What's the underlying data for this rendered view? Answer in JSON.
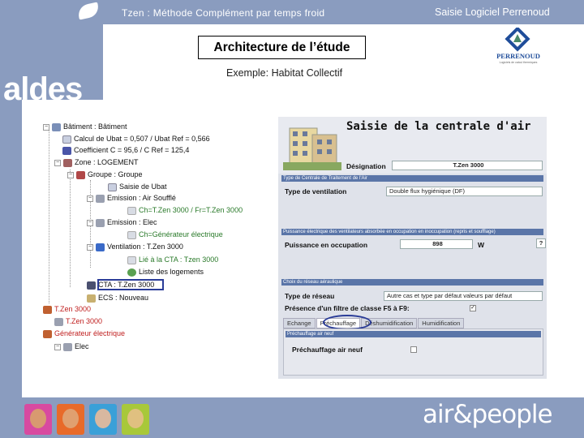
{
  "header": {
    "left_text": "Tzen : Méthode Complément par temps froid",
    "right_text": "Saisie Logiciel Perrenoud"
  },
  "brand": {
    "aldes": "aldes",
    "perrenoud": "PERRENOUD",
    "perrenoud_tagline": "Logiciels de calcul thermiques",
    "footer": "air&people"
  },
  "slide": {
    "title": "Architecture de l’étude",
    "subtitle": "Exemple: Habitat Collectif"
  },
  "tree": {
    "items": [
      {
        "label": "Bâtiment : Bâtiment",
        "icon": "building-icon"
      },
      {
        "label": "Calcul de Ubat = 0,507 / Ubat Ref = 0,566",
        "icon": "ubat-icon"
      },
      {
        "label": "Coefficient C = 95,6 / C Ref = 125,4",
        "icon": "coefficient-icon"
      },
      {
        "label": "Zone : LOGEMENT",
        "icon": "zone-icon"
      },
      {
        "label": "Groupe : Groupe",
        "icon": "group-icon"
      },
      {
        "label": "Saisie de Ubat",
        "icon": "ubat-icon"
      },
      {
        "label": "Emission : Air Soufflé",
        "icon": "emission-icon"
      },
      {
        "label": "Ch=T.Zen 3000 / Fr=T.Zen 3000",
        "icon": "link-icon"
      },
      {
        "label": "Emission : Elec",
        "icon": "emission-icon"
      },
      {
        "label": "Ch=Générateur électrique",
        "icon": "link-icon"
      },
      {
        "label": "Ventilation : T.Zen 3000",
        "icon": "ventilation-icon"
      },
      {
        "label": "Lié à la CTA : Tzen 3000",
        "icon": "link-icon"
      },
      {
        "label": "Liste des logements",
        "icon": "list-icon"
      },
      {
        "label": "CTA : T.Zen 3000",
        "icon": "cta-icon"
      },
      {
        "label": "ECS : Nouveau",
        "icon": "ecs-icon"
      },
      {
        "label": "T.Zen 3000",
        "icon": "generator-icon"
      },
      {
        "label": "T.Zen 3000",
        "icon": "generator-icon"
      },
      {
        "label": "Générateur électrique",
        "icon": "generator-icon"
      },
      {
        "label": "Elec",
        "icon": "emission-icon"
      }
    ]
  },
  "form": {
    "title": "Saisie de la centrale d'air",
    "designation_label": "Désignation",
    "designation_value": "T.Zen 3000",
    "section_ventilation": "Type de Centrale de Traitement de l'Air",
    "type_ventilation_label": "Type de ventilation",
    "type_ventilation_value": "Double flux hygiénique (DF)",
    "section_power": "Puissance électrique des ventilateurs absorbée en occupation en inoccupation (repris et soufflage)",
    "power_label": "Puissance en occupation",
    "power_value": "898",
    "power_unit": "W",
    "help": "?",
    "section_network": "Choix du réseau aéraulique",
    "network_label": "Type de réseau",
    "network_value": "Autre cas et type par défaut valeurs par défaut",
    "filter_label": "Présence d'un filtre de classe F5 à F9:",
    "filter_checked": "✓",
    "tabs": [
      "Echange",
      "Préchauffage",
      "Déshumidification",
      "Humidification"
    ],
    "active_tab": "Préchauffage",
    "panel_title": "Préchauffage air neuf",
    "preheat_label": "Préchauffage air neuf"
  },
  "colors": {
    "background": "#8a9cbf",
    "section_bar": "#5a75a8",
    "highlight": "#2a3c98",
    "perrenoud_blue": "#1f4d9a"
  }
}
